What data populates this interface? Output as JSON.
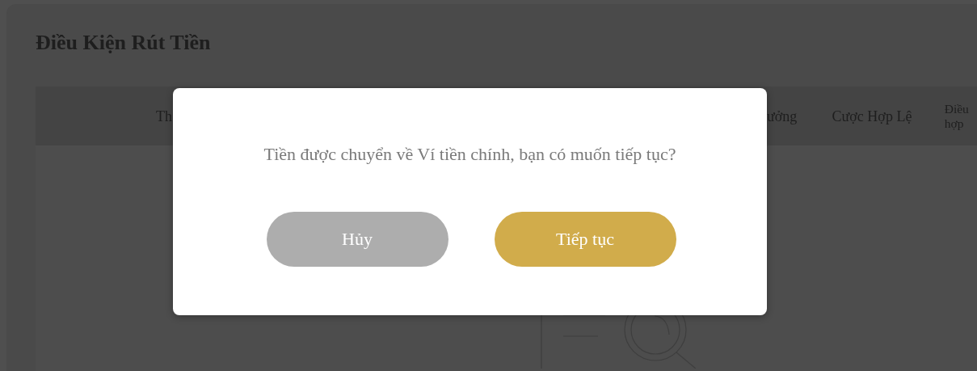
{
  "page_title": "Điều Kiện Rút Tiền",
  "tabs": [
    {
      "label": "Th"
    },
    {
      "label": "ưởng"
    },
    {
      "label": "Cược Hợp Lệ"
    },
    {
      "label": "Điều hợp"
    }
  ],
  "dialog": {
    "message": "Tiền được chuyển về Ví tiền chính, bạn có muốn tiếp tục?",
    "buttons": [
      {
        "kind": "cancel",
        "label": "Hủy"
      },
      {
        "kind": "confirm",
        "label": "Tiếp tục"
      }
    ]
  }
}
